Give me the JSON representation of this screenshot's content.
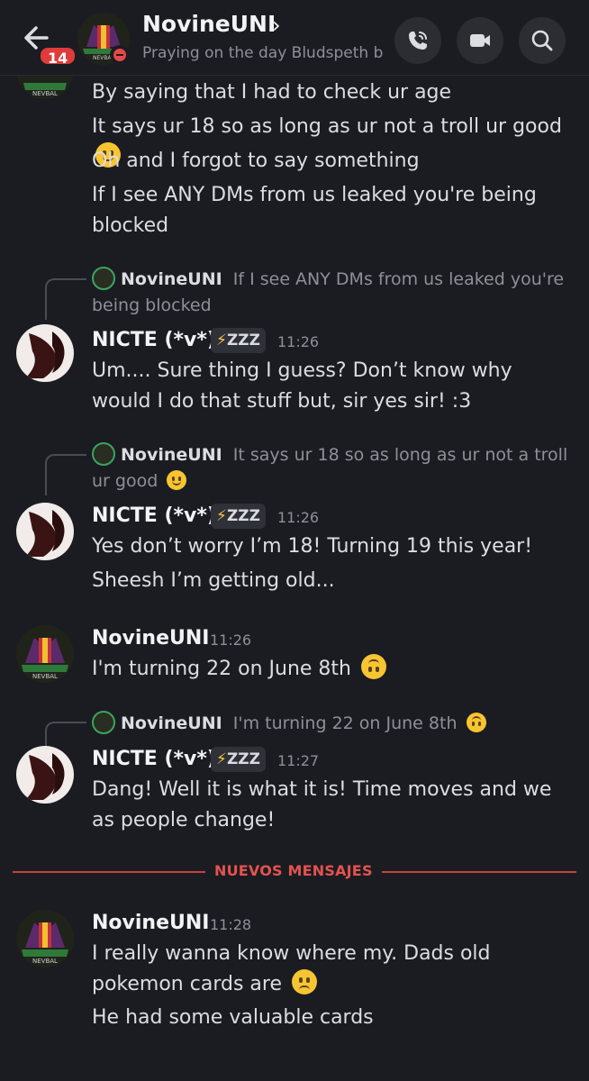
{
  "header": {
    "unread_count": "14",
    "name": "NovineUNI",
    "chevron": "›",
    "status": "Praying on the day Bludspeth b...",
    "icons": [
      "back-arrow-icon",
      "phone-icon",
      "video-icon",
      "search-icon"
    ]
  },
  "messages": {
    "cont_lines": [
      "By saying that I had to check ur age",
      "It says ur 18 so as long as ur not a troll ur good",
      "Oh and I forgot to say something",
      "If I see ANY DMs from us leaked you're being blocked"
    ],
    "m1": {
      "reply_author": "NovineUNI",
      "reply_text": "If I see ANY DMs from us leaked you're being blocked",
      "author": "NICTE (*v*)",
      "tag": "ZZZ",
      "time": "11:26",
      "text": "Um.... Sure thing I guess? Don’t know why would I do that stuff but, sir yes sir! :3"
    },
    "m2": {
      "reply_author": "NovineUNI",
      "reply_text": "It says ur 18 so as long as ur not a troll ur good",
      "author": "NICTE (*v*)",
      "tag": "ZZZ",
      "time": "11:26",
      "lines": [
        "Yes don’t worry I’m 18! Turning 19 this year!",
        "Sheesh I’m getting old..."
      ]
    },
    "m3": {
      "author": "NovineUNI",
      "time": "11:26",
      "text": "I'm turning 22 on June 8th"
    },
    "m4": {
      "reply_author": "NovineUNI",
      "reply_text": "I'm turning 22 on June 8th",
      "author": "NICTE (*v*)",
      "tag": "ZZZ",
      "time": "11:27",
      "text": "Dang! Well it is what it is! Time moves and we as people change!"
    },
    "new_divider": "NUEVOS MENSAJES",
    "m5": {
      "author": "NovineUNI",
      "time": "11:28",
      "text": "I really wanna know where my. Dads old pokemon cards are",
      "line2": "He had some valuable cards"
    }
  },
  "colors": {
    "background": "#1b1c22",
    "accent_red": "#e5524f",
    "dnd": "#e74848",
    "muted_text": "#8e9099"
  }
}
